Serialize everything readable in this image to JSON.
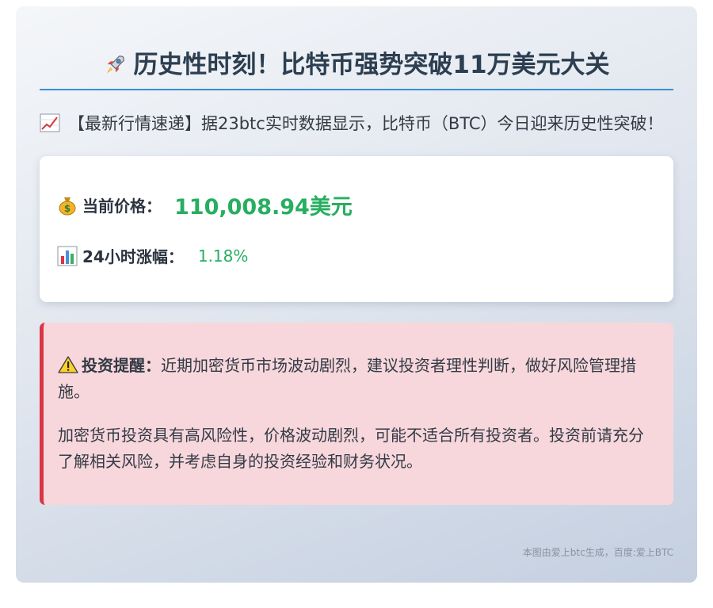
{
  "title": "历史性时刻！比特币强势突破11万美元大关",
  "title_icon": "rocket-icon",
  "intro": {
    "icon": "chart-increasing-icon",
    "text": "【最新行情速递】据23btc实时数据显示，比特币（BTC）今日迎来历史性突破！"
  },
  "price_box": {
    "price_icon": "money-bag-icon",
    "price_label": "当前价格：",
    "price_value": "110,008.94美元",
    "change_icon": "bar-chart-icon",
    "change_label": "24小时涨幅：",
    "change_value": "1.18%"
  },
  "warning": {
    "icon": "warning-icon",
    "title": "投资提醒：",
    "text1": "近期加密货币市场波动剧烈，建议投资者理性判断，做好风险管理措施。",
    "text2": "加密货币投资具有高风险性，价格波动剧烈，可能不适合所有投资者。投资前请充分了解相关风险，并考虑自身的投资经验和财务状况。"
  },
  "footer": "本图由爱上btc生成，百度:爱上BTC",
  "colors": {
    "accent_line": "#3a8fd0",
    "positive": "#27ae60",
    "warning_border": "#d93545",
    "warning_bg": "#f7d7dc"
  }
}
